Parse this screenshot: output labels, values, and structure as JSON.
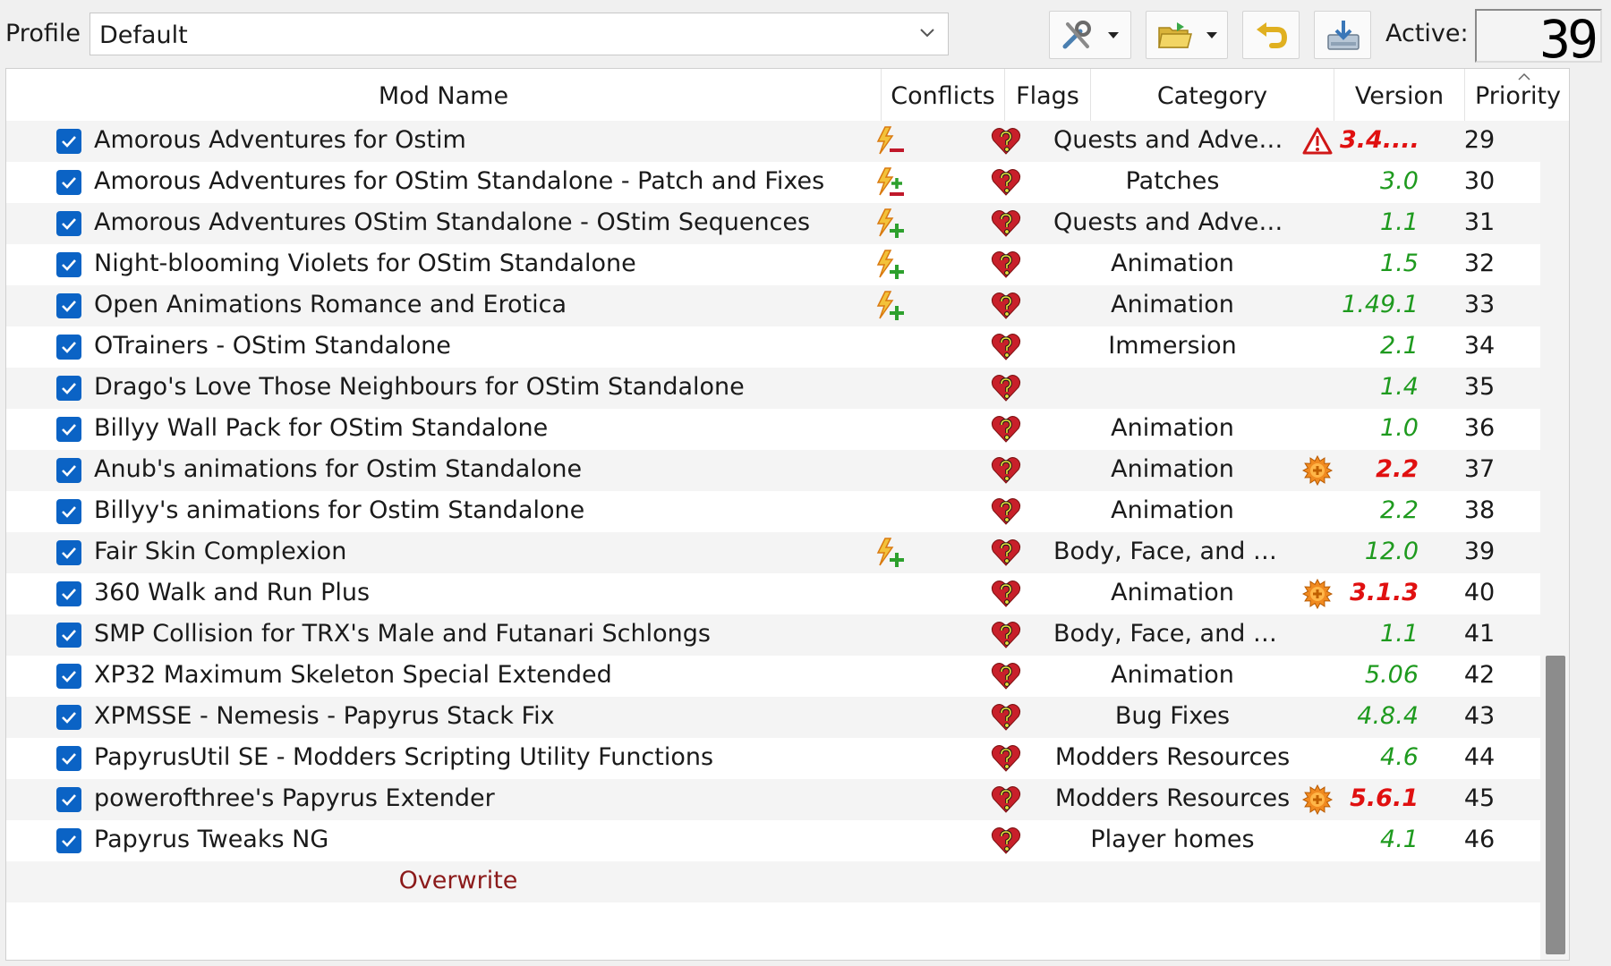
{
  "profile": {
    "label": "Profile",
    "value": "Default"
  },
  "toolbar": {
    "tools_icon": "tools-icon",
    "folder_icon": "open-folder-icon",
    "undo_icon": "undo-icon",
    "install_icon": "install-icon"
  },
  "active": {
    "label": "Active:",
    "count": "39"
  },
  "columns": {
    "mod_name": "Mod Name",
    "conflicts": "Conflicts",
    "flags": "Flags",
    "category": "Category",
    "version": "Version",
    "priority": "Priority"
  },
  "mods": [
    {
      "name": "Amorous Adventures for Ostim",
      "conflict": "conflict-lose-icon",
      "category": "Quests and Adven...",
      "version_icon": "warning-icon",
      "version": "3.4....",
      "version_status": "bad",
      "priority": "29"
    },
    {
      "name": "Amorous Adventures for OStim Standalone - Patch and Fixes",
      "conflict": "conflict-mixed-icon",
      "category": "Patches",
      "version_icon": "",
      "version": "3.0",
      "version_status": "ok",
      "priority": "30"
    },
    {
      "name": "Amorous Adventures OStim Standalone - OStim Sequences",
      "conflict": "conflict-win-icon",
      "category": "Quests and Adven...",
      "version_icon": "",
      "version": "1.1",
      "version_status": "ok",
      "priority": "31"
    },
    {
      "name": "Night-blooming Violets for OStim Standalone",
      "conflict": "conflict-win-icon",
      "category": "Animation",
      "version_icon": "",
      "version": "1.5",
      "version_status": "ok",
      "priority": "32"
    },
    {
      "name": "Open Animations Romance and Erotica",
      "conflict": "conflict-win-icon",
      "category": "Animation",
      "version_icon": "",
      "version": "1.49.1",
      "version_status": "ok",
      "priority": "33"
    },
    {
      "name": "OTrainers - OStim Standalone",
      "conflict": "",
      "category": "Immersion",
      "version_icon": "",
      "version": "2.1",
      "version_status": "ok",
      "priority": "34"
    },
    {
      "name": "Drago's Love Those Neighbours for OStim Standalone",
      "conflict": "",
      "category": "",
      "version_icon": "",
      "version": "1.4",
      "version_status": "ok",
      "priority": "35"
    },
    {
      "name": "Billyy Wall Pack for OStim Standalone",
      "conflict": "",
      "category": "Animation",
      "version_icon": "",
      "version": "1.0",
      "version_status": "ok",
      "priority": "36"
    },
    {
      "name": "Anub's animations for Ostim Standalone",
      "conflict": "",
      "category": "Animation",
      "version_icon": "update-star-icon",
      "version": "2.2",
      "version_status": "bad",
      "priority": "37"
    },
    {
      "name": "Billyy's animations for Ostim Standalone",
      "conflict": "",
      "category": "Animation",
      "version_icon": "",
      "version": "2.2",
      "version_status": "ok",
      "priority": "38"
    },
    {
      "name": "Fair Skin Complexion",
      "conflict": "conflict-win-icon",
      "category": "Body, Face, and Hair",
      "version_icon": "",
      "version": "12.0",
      "version_status": "ok",
      "priority": "39"
    },
    {
      "name": "360 Walk and Run Plus",
      "conflict": "",
      "category": "Animation",
      "version_icon": "update-star-icon",
      "version": "3.1.3",
      "version_status": "bad",
      "priority": "40"
    },
    {
      "name": "SMP Collision for TRX's Male and Futanari Schlongs",
      "conflict": "",
      "category": "Body, Face, and Hair",
      "version_icon": "",
      "version": "1.1",
      "version_status": "ok",
      "priority": "41"
    },
    {
      "name": "XP32 Maximum Skeleton Special Extended",
      "conflict": "",
      "category": "Animation",
      "version_icon": "",
      "version": "5.06",
      "version_status": "ok",
      "priority": "42"
    },
    {
      "name": "XPMSSE - Nemesis - Papyrus Stack Fix",
      "conflict": "",
      "category": "Bug Fixes",
      "version_icon": "",
      "version": "4.8.4",
      "version_status": "ok",
      "priority": "43"
    },
    {
      "name": "PapyrusUtil SE - Modders Scripting Utility Functions",
      "conflict": "",
      "category": "Modders Resources",
      "version_icon": "",
      "version": "4.6",
      "version_status": "ok",
      "priority": "44"
    },
    {
      "name": "powerofthree's Papyrus Extender",
      "conflict": "",
      "category": "Modders Resources",
      "version_icon": "update-star-icon",
      "version": "5.6.1",
      "version_status": "bad",
      "priority": "45"
    },
    {
      "name": "Papyrus Tweaks NG",
      "conflict": "",
      "category": "Player homes",
      "version_icon": "",
      "version": "4.1",
      "version_status": "ok",
      "priority": "46"
    }
  ],
  "overwrite": "Overwrite",
  "flag_icon": "missing-nexus-id-heart-icon",
  "colors": {
    "version_ok": "#1e9a1e",
    "version_bad": "#e01010",
    "overwrite": "#8b1a1a",
    "checkbox": "#0b63c5"
  }
}
